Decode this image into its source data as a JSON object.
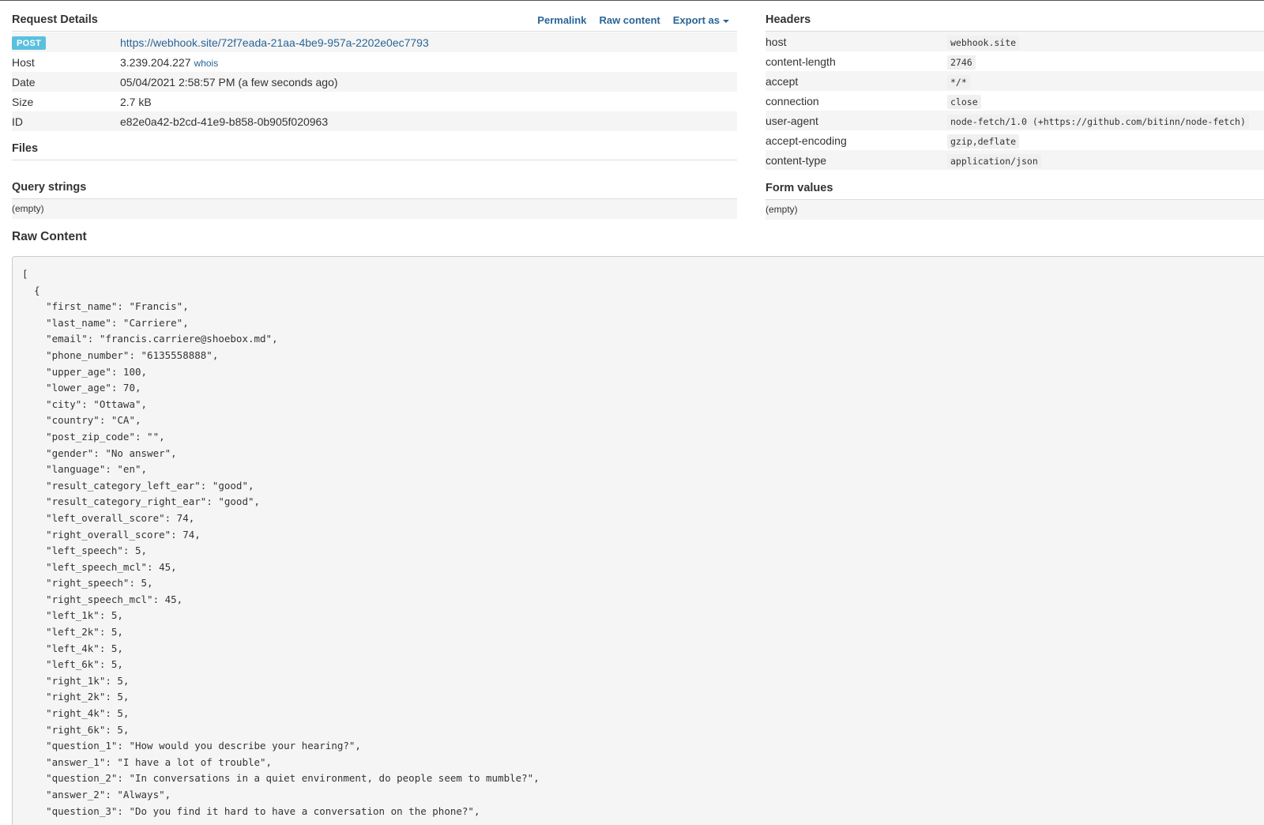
{
  "request": {
    "title": "Request Details",
    "links": {
      "permalink": "Permalink",
      "raw": "Raw content",
      "export": "Export as"
    },
    "method": "POST",
    "url": "https://webhook.site/72f7eada-21aa-4be9-957a-2202e0ec7793",
    "host_label": "Host",
    "host": "3.239.204.227",
    "whois": "whois",
    "date_label": "Date",
    "date": "05/04/2021 2:58:57 PM (a few seconds ago)",
    "size_label": "Size",
    "size": "2.7 kB",
    "id_label": "ID",
    "id": "e82e0a42-b2cd-41e9-b858-0b905f020963"
  },
  "files": {
    "title": "Files"
  },
  "query": {
    "title": "Query strings",
    "value": "(empty)"
  },
  "headers": {
    "title": "Headers",
    "rows": [
      {
        "k": "host",
        "v": "webhook.site"
      },
      {
        "k": "content-length",
        "v": "2746"
      },
      {
        "k": "accept",
        "v": "*/*"
      },
      {
        "k": "connection",
        "v": "close"
      },
      {
        "k": "user-agent",
        "v": "node-fetch/1.0 (+https://github.com/bitinn/node-fetch)"
      },
      {
        "k": "accept-encoding",
        "v": "gzip,deflate"
      },
      {
        "k": "content-type",
        "v": "application/json"
      }
    ]
  },
  "form": {
    "title": "Form values",
    "value": "(empty)"
  },
  "raw": {
    "title": "Raw Content",
    "lines": [
      "[",
      "  {",
      "    \"first_name\": \"Francis\",",
      "    \"last_name\": \"Carriere\",",
      "    \"email\": \"francis.carriere@shoebox.md\",",
      "    \"phone_number\": \"6135558888\",",
      "    \"upper_age\": 100,",
      "    \"lower_age\": 70,",
      "    \"city\": \"Ottawa\",",
      "    \"country\": \"CA\",",
      "    \"post_zip_code\": \"\",",
      "    \"gender\": \"No answer\",",
      "    \"language\": \"en\",",
      "    \"result_category_left_ear\": \"good\",",
      "    \"result_category_right_ear\": \"good\",",
      "    \"left_overall_score\": 74,",
      "    \"right_overall_score\": 74,",
      "    \"left_speech\": 5,",
      "    \"left_speech_mcl\": 45,",
      "    \"right_speech\": 5,",
      "    \"right_speech_mcl\": 45,",
      "    \"left_1k\": 5,",
      "    \"left_2k\": 5,",
      "    \"left_4k\": 5,",
      "    \"left_6k\": 5,",
      "    \"right_1k\": 5,",
      "    \"right_2k\": 5,",
      "    \"right_4k\": 5,",
      "    \"right_6k\": 5,",
      "    \"question_1\": \"How would you describe your hearing?\",",
      "    \"answer_1\": \"I have a lot of trouble\",",
      "    \"question_2\": \"In conversations in a quiet environment, do people seem to mumble?\",",
      "    \"answer_2\": \"Always\",",
      "    \"question_3\": \"Do you find it hard to have a conversation on the phone?\","
    ]
  }
}
